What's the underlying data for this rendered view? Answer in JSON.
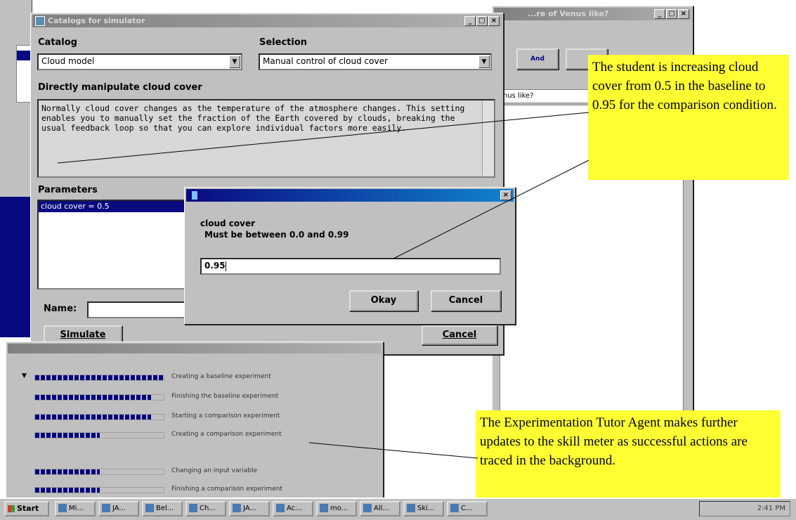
{
  "catalog_window": {
    "title": "Catalogs for simulator",
    "catalog_label": "Catalog",
    "catalog_value": "Cloud model",
    "selection_label": "Selection",
    "selection_value": "Manual control of cloud cover",
    "description_heading": "Directly manipulate cloud cover",
    "description_text": "Normally cloud cover changes as the temperature of the atmosphere changes.  This setting enables you to manually set the fraction of the Earth covered by clouds, breaking the usual feedback loop so that you can explore individual factors more easily.",
    "parameters_label": "Parameters",
    "parameter_item": "cloud cover = 0.5",
    "name_label": "Name:",
    "simulate_button": "Simulate",
    "cancel_button": "Cancel"
  },
  "back_window": {
    "title": "...re of Venus like?",
    "question_partial": "nus like?",
    "toolbar_btn": "And"
  },
  "input_dialog": {
    "prompt_line1": "cloud cover",
    "prompt_line2": "Must be between 0.0 and 0.99",
    "input_value": "0.95",
    "okay_button": "Okay",
    "cancel_button": "Cancel"
  },
  "skill_meter": {
    "items": [
      {
        "label": "Creating a baseline experiment",
        "level": 1.0
      },
      {
        "label": "Finishing the baseline experiment",
        "level": 0.9
      },
      {
        "label": "Starting a comparison experiment",
        "level": 0.9
      },
      {
        "label": "Creating a comparison experiment",
        "level": 0.5
      },
      {
        "label": "Changing an input variable",
        "level": 0.5
      },
      {
        "label": "Finishing a comparison experiment",
        "level": 0.5
      }
    ]
  },
  "annotations": {
    "note1": "The student is increasing cloud cover from 0.5 in the baseline to 0.95 for the comparison condition.",
    "note2": "The Experimentation Tutor Agent makes further updates to the skill meter as successful actions are traced in the background."
  },
  "taskbar": {
    "start": "Start",
    "items": [
      "Mi...",
      "JA...",
      "Bel...",
      "Ch...",
      "JA...",
      "Ac...",
      "mo...",
      "All...",
      "Ski...",
      "C..."
    ],
    "clock": "2:41 PM"
  },
  "colors": {
    "title_blue": "#0a0a80",
    "note_yellow": "#ffff33",
    "window_gray": "#c0c0c0"
  }
}
